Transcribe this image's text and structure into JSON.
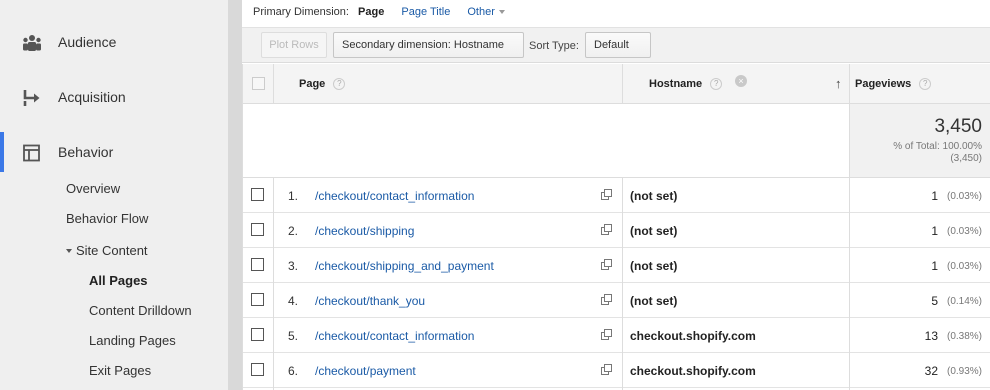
{
  "sidebar": {
    "sections": [
      {
        "label": "Audience",
        "icon": "people-icon"
      },
      {
        "label": "Acquisition",
        "icon": "acquisition-arrow-icon"
      },
      {
        "label": "Behavior",
        "icon": "behavior-layout-icon"
      }
    ],
    "behavior_items": [
      "Overview",
      "Behavior Flow"
    ],
    "site_content_label": "Site Content",
    "site_content_items": [
      "All Pages",
      "Content Drilldown",
      "Landing Pages",
      "Exit Pages"
    ],
    "active_item": "All Pages",
    "accent_color": "#3b78e7"
  },
  "primary_dimension": {
    "label": "Primary Dimension:",
    "active": "Page",
    "options": [
      "Page Title",
      "Other"
    ]
  },
  "toolbar": {
    "plot_rows": "Plot Rows",
    "secondary_dimension": "Secondary dimension: Hostname",
    "sort_type_label": "Sort Type:",
    "sort_type_value": "Default"
  },
  "table": {
    "headers": {
      "page": "Page",
      "hostname": "Hostname",
      "pageviews": "Pageviews"
    },
    "help_glyph": "?",
    "close_glyph": "×",
    "sort_glyph": "↑",
    "totals": {
      "value": "3,450",
      "pct_label": "% of Total: 100.00%",
      "pct_paren": "(3,450)"
    },
    "rows": [
      {
        "idx": "1.",
        "page": "/checkout/contact_information",
        "host": "(not set)",
        "pv": "1",
        "pct": "(0.03%)"
      },
      {
        "idx": "2.",
        "page": "/checkout/shipping",
        "host": "(not set)",
        "pv": "1",
        "pct": "(0.03%)"
      },
      {
        "idx": "3.",
        "page": "/checkout/shipping_and_payment",
        "host": "(not set)",
        "pv": "1",
        "pct": "(0.03%)"
      },
      {
        "idx": "4.",
        "page": "/checkout/thank_you",
        "host": "(not set)",
        "pv": "5",
        "pct": "(0.14%)"
      },
      {
        "idx": "5.",
        "page": "/checkout/contact_information",
        "host": "checkout.shopify.com",
        "pv": "13",
        "pct": "(0.38%)"
      },
      {
        "idx": "6.",
        "page": "/checkout/payment",
        "host": "checkout.shopify.com",
        "pv": "32",
        "pct": "(0.93%)"
      }
    ]
  }
}
